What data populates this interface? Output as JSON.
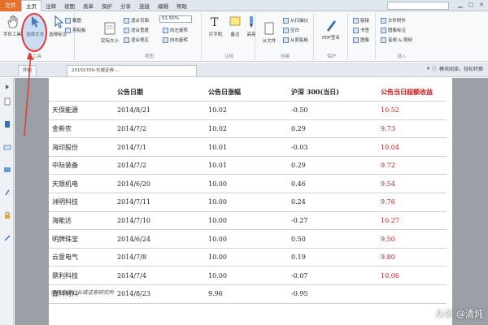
{
  "menubar": {
    "file": "文件",
    "items": [
      "主页",
      "注释",
      "视图",
      "表单",
      "保护",
      "分享",
      "连接",
      "编辑",
      "帮助"
    ],
    "active_index": 0,
    "search_placeholder": ""
  },
  "ribbon": {
    "hand_tool": "手形工具",
    "select_text": "选择文本",
    "select_annotation": "选择标注",
    "snapshot": "截图",
    "clipboard": "剪贴板",
    "actual_size": "实际大小",
    "zoom_value": "51.50%",
    "page_options": [
      "适合页面",
      "适合宽度",
      "适合视区",
      "向左旋转",
      "向右旋转"
    ],
    "typewriter": "打字机",
    "note": "备注",
    "highlight": "高亮",
    "convert": "从文件",
    "create_group": [
      "从扫描仪",
      "空白",
      "从剪贴板"
    ],
    "sign": "PDF签名",
    "link": "链接",
    "bookmark": "书签",
    "image": "图像",
    "insert": [
      "文件附件",
      "图像标注",
      "音频 & 视频"
    ],
    "group_labels": [
      "工具",
      "视图",
      "注释",
      "创建",
      "保护",
      "插入"
    ]
  },
  "tabs": {
    "start": "开始",
    "doc": "20150709-长城证券-...",
    "right_text": "模块阅读，轻松转换"
  },
  "table": {
    "headers": [
      "",
      "公告日期",
      "公告日涨幅",
      "沪深 300(当日)",
      "公告当日超额收益"
    ],
    "rows": [
      [
        "天保能源",
        "2014/8/21",
        "10.02",
        "-0.50",
        "10.52"
      ],
      [
        "金新农",
        "2014/7/2",
        "10.02",
        "0.29",
        "9.73"
      ],
      [
        "海印股份",
        "2014/7/1",
        "10.01",
        "-0.03",
        "10.04"
      ],
      [
        "中际装备",
        "2014/7/2",
        "10.01",
        "0.29",
        "9.72"
      ],
      [
        "天银机电",
        "2014/6/20",
        "10.00",
        "0.46",
        "9.54"
      ],
      [
        "洲明科技",
        "2014/7/11",
        "10.00",
        "0.24",
        "9.76"
      ],
      [
        "海能达",
        "2014/7/10",
        "10.00",
        "-0.27",
        "10.27"
      ],
      [
        "明牌珠宝",
        "2014/6/24",
        "10.00",
        "0.50",
        "9.50"
      ],
      [
        "云意电气",
        "2014/7/8",
        "10.00",
        "0.19",
        "9.80"
      ],
      [
        "鼎利科技",
        "2014/7/4",
        "10.00",
        "-0.07",
        "10.06"
      ],
      [
        "鑫科材料",
        "2014/8/23",
        "9.96",
        "-0.95",
        ""
      ]
    ],
    "source": "资料来源：长城证券研究所"
  },
  "watermark": "头条 @清炖",
  "colors": {
    "accent_red": "#c81e1e",
    "file_tab": "#e5712a",
    "highlight": "#e03a3a"
  }
}
